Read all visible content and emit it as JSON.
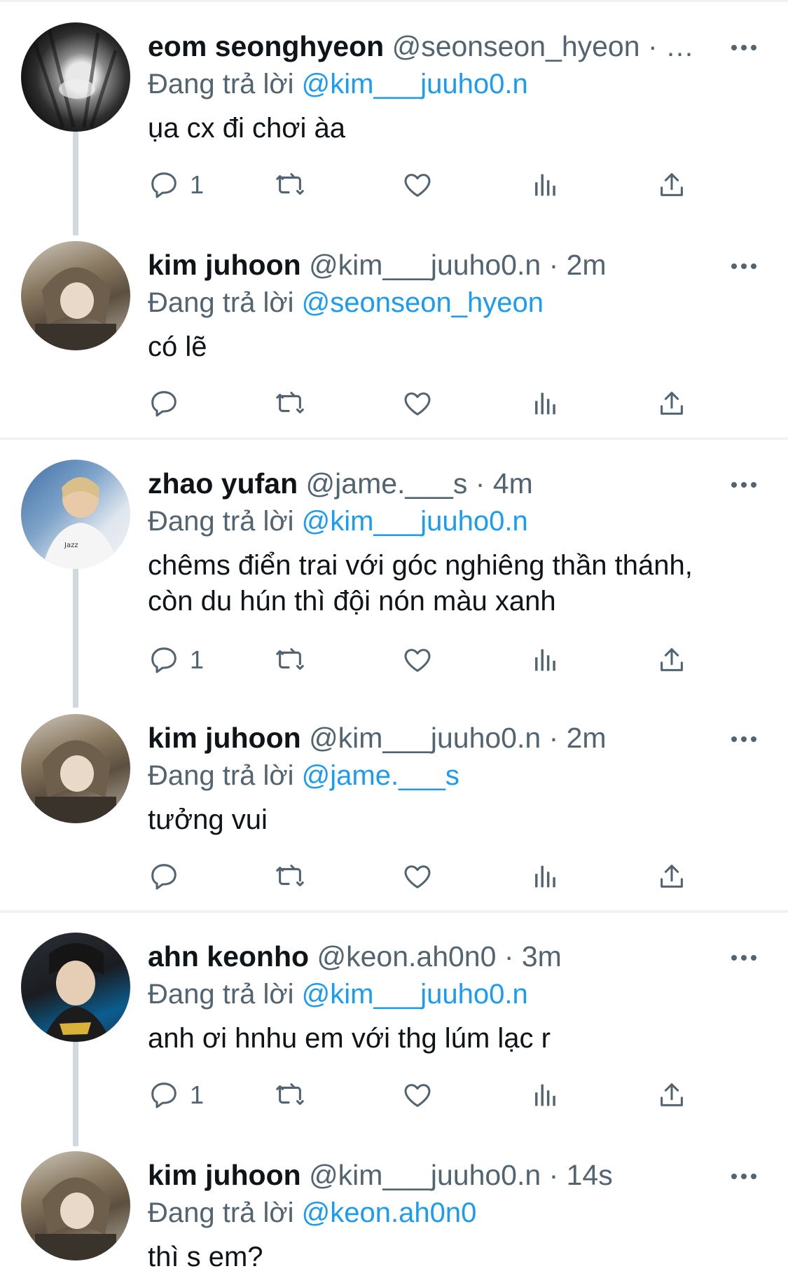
{
  "reply_prefix": "Đang trả lời",
  "colors": {
    "mention": "#1d9bf0",
    "muted": "#536471",
    "thread": "#cfd9de"
  },
  "tweets": [
    {
      "name": "eom seonghyeon",
      "handle": "@seonseon_hyeon",
      "time": "· …",
      "reply_to": "@kim___juuho0.n",
      "text": "ụa cx đi chơi àa",
      "reply_count": "1"
    },
    {
      "name": "kim juhoon",
      "handle": "@kim___juuho0.n",
      "time": "· 2m",
      "reply_to": "@seonseon_hyeon",
      "text": "có lẽ",
      "reply_count": ""
    },
    {
      "name": "zhao yufan",
      "handle": "@jame.___s",
      "time": "· 4m",
      "reply_to": "@kim___juuho0.n",
      "text": "chêms điển trai với góc nghiêng thần thánh,\ncòn du hún thì đội nón màu xanh",
      "reply_count": "1"
    },
    {
      "name": "kim juhoon",
      "handle": "@kim___juuho0.n",
      "time": "· 2m",
      "reply_to": "@jame.___s",
      "text": "tưởng vui",
      "reply_count": ""
    },
    {
      "name": "ahn keonho",
      "handle": "@keon.ah0n0",
      "time": "· 3m",
      "reply_to": "@kim___juuho0.n",
      "text": "anh ơi hnhu em với thg lúm lạc r",
      "reply_count": "1"
    },
    {
      "name": "kim juhoon",
      "handle": "@kim___juuho0.n",
      "time": "· 14s",
      "reply_to": "@keon.ah0n0",
      "text": "thì s em?",
      "reply_count": ""
    }
  ]
}
